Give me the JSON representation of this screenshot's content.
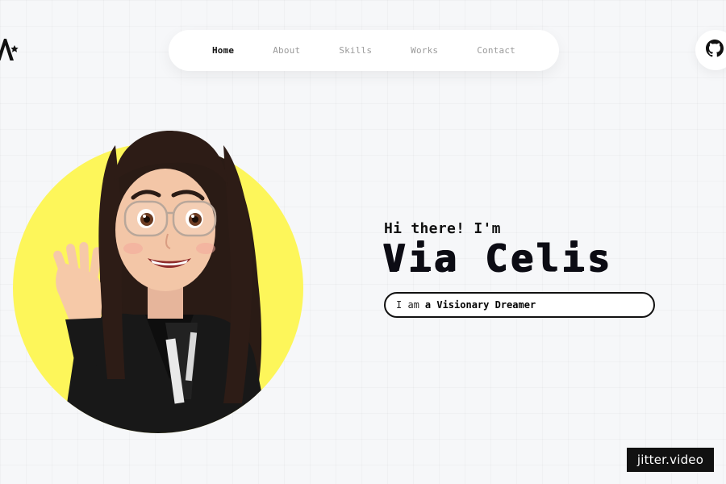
{
  "header": {
    "logo_icon": "a-star-logo-icon",
    "nav": {
      "items": [
        {
          "label": "Home",
          "active": true
        },
        {
          "label": "About",
          "active": false
        },
        {
          "label": "Skills",
          "active": false
        },
        {
          "label": "Works",
          "active": false
        },
        {
          "label": "Contact",
          "active": false
        }
      ]
    },
    "github_icon": "github-icon"
  },
  "hero": {
    "greeting": "Hi there! I'm",
    "name": "Via Celis",
    "role_prefix": "I am",
    "role": "a Visionary Dreamer",
    "avatar_icon": "memoji-avatar-waving",
    "avatar_bg_color": "#fdf65a"
  },
  "watermark": {
    "text": "jitter.video"
  },
  "colors": {
    "background": "#f6f7f9",
    "text_primary": "#111111",
    "nav_inactive": "#9a9a9a",
    "accent_yellow": "#fdf65a"
  }
}
